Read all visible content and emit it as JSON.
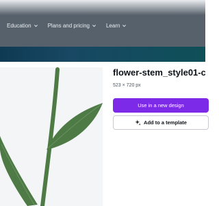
{
  "nav": {
    "items": [
      {
        "label": "Education",
        "icon": "chevron-down-icon"
      },
      {
        "label": "Plans and pricing",
        "icon": "chevron-down-icon"
      },
      {
        "label": "Learn",
        "icon": "chevron-down-icon"
      }
    ]
  },
  "asset": {
    "title": "flower-stem_style01-c",
    "dimensions": "523 × 720 px"
  },
  "actions": {
    "use_label": "Use in a new design",
    "template_label": "Add to a template",
    "template_icon": "sparkle-icon"
  },
  "colors": {
    "nav_bg": "#57616b",
    "primary_button": "#7d2ae8",
    "stem_green": "#4e7a45"
  }
}
